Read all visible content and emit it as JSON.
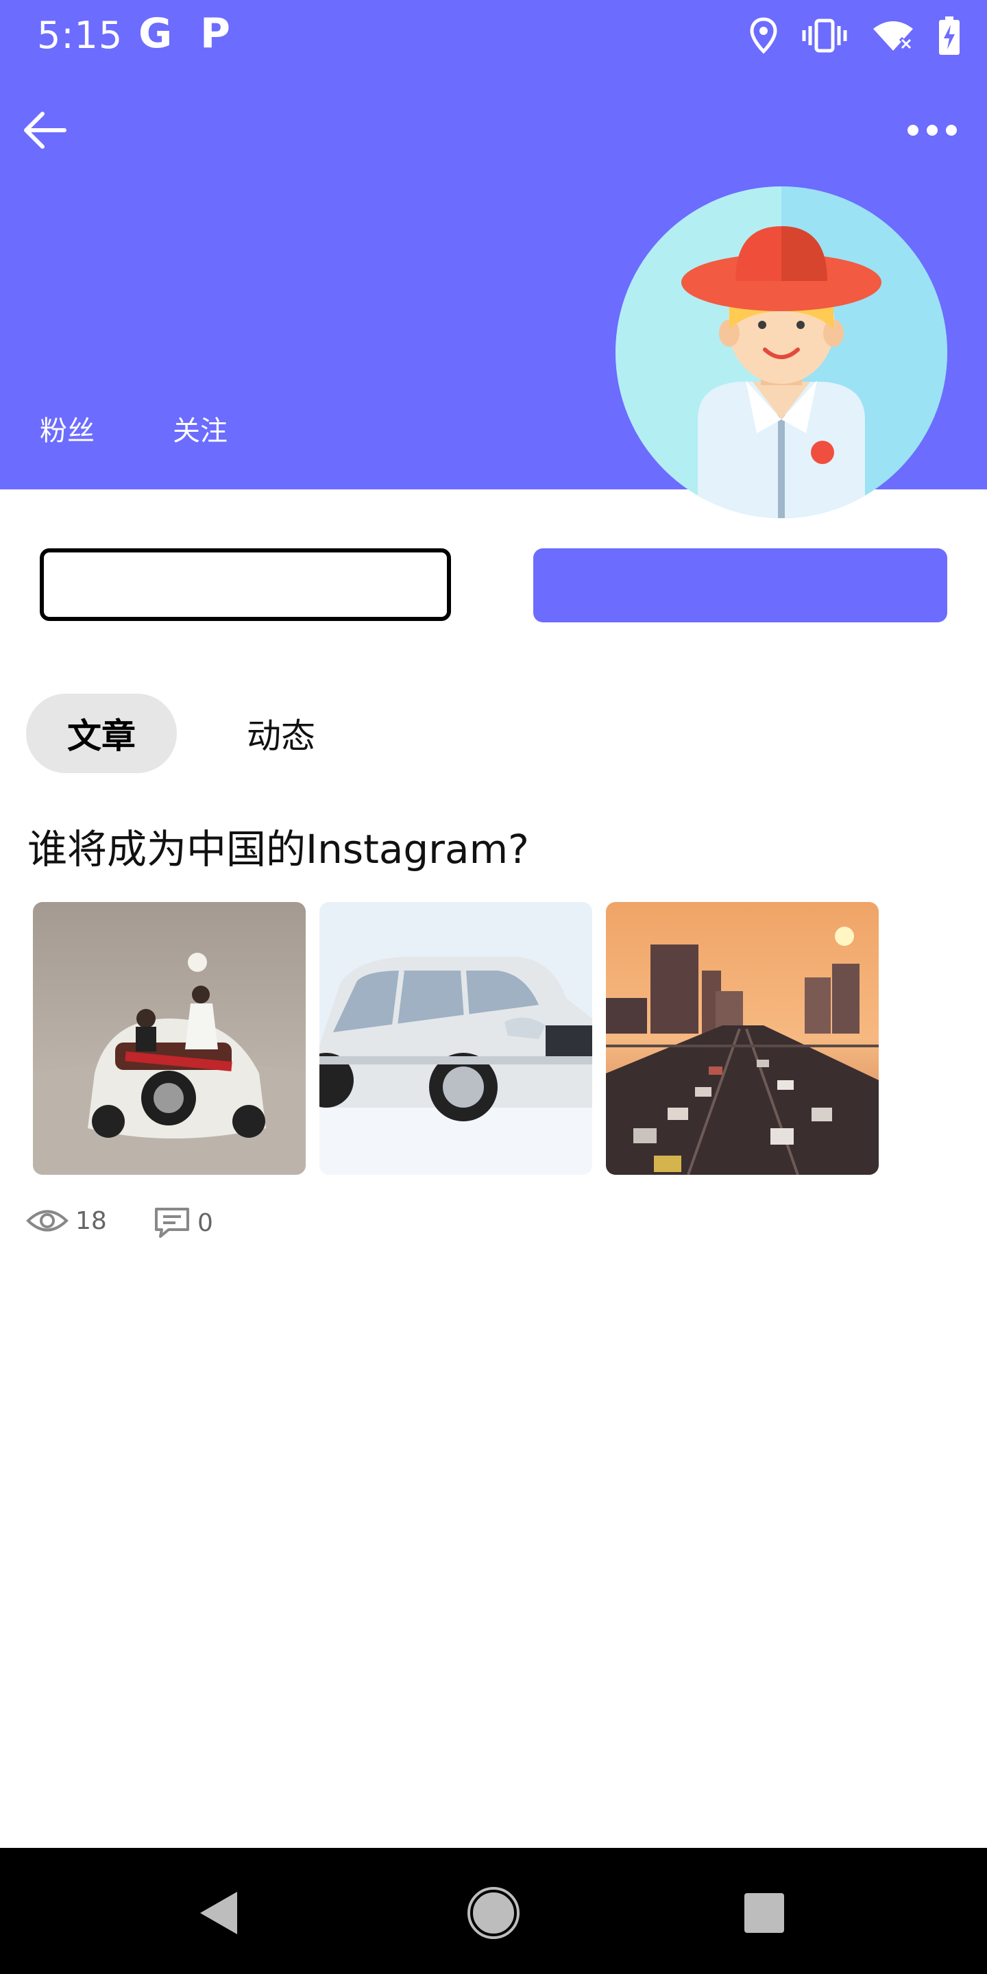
{
  "status_bar": {
    "time": "5:15",
    "app_icon_1": "G",
    "app_icon_2": "P",
    "icons": [
      "location-icon",
      "vibrate-icon",
      "wifi-icon",
      "battery-icon"
    ]
  },
  "header": {
    "fans_label": "粉丝",
    "following_label": "关注",
    "color": "#6c6cff"
  },
  "actions": {
    "follow_label": "",
    "message_label": ""
  },
  "tabs": [
    {
      "label": "文章",
      "active": true
    },
    {
      "label": "动态",
      "active": false
    }
  ],
  "article": {
    "title": "谁将成为中国的Instagram?",
    "images": [
      "wedding-car-photo",
      "white-suv-photo",
      "city-traffic-sunset-photo"
    ],
    "views": "18",
    "comments": "0"
  },
  "nav": [
    "back",
    "home",
    "recent"
  ]
}
